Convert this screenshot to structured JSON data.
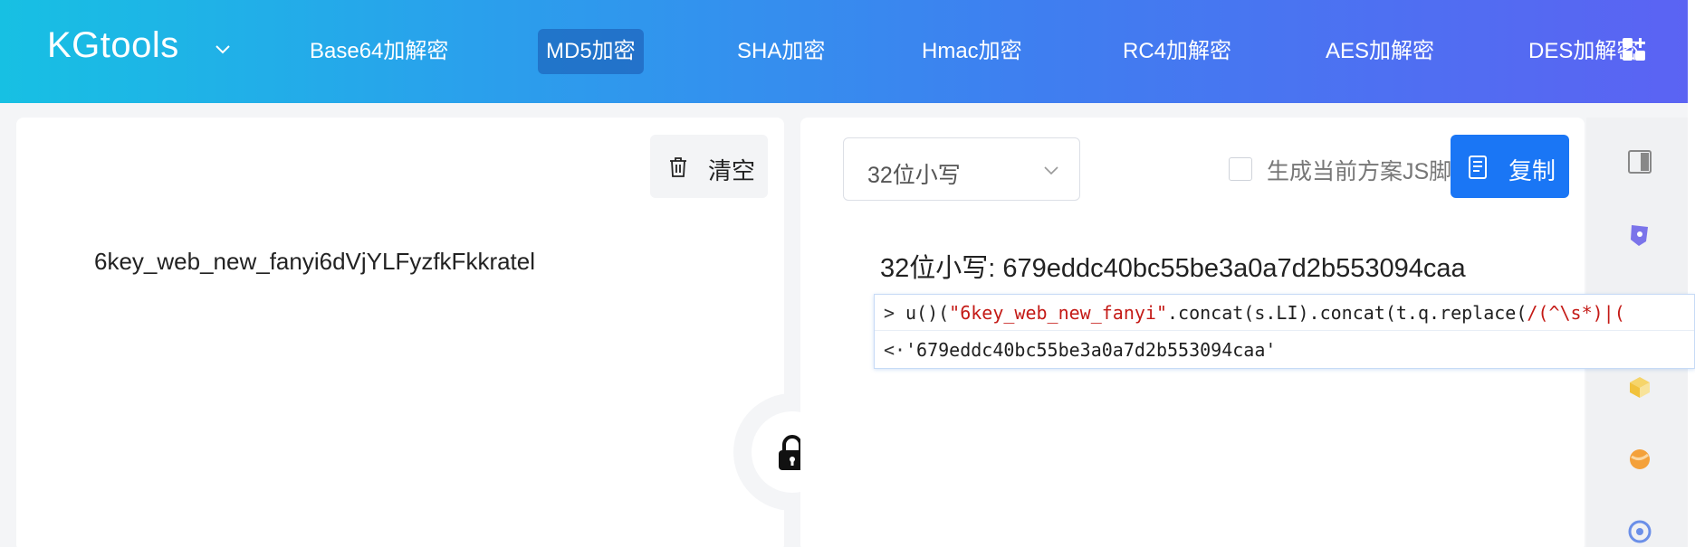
{
  "header": {
    "logo": "KGtools",
    "nav": [
      {
        "label": "Base64加解密",
        "active": false
      },
      {
        "label": "MD5加密",
        "active": true
      },
      {
        "label": "SHA加密",
        "active": false
      },
      {
        "label": "Hmac加密",
        "active": false
      },
      {
        "label": "RC4加解密",
        "active": false
      },
      {
        "label": "AES加解密",
        "active": false
      },
      {
        "label": "DES加解密",
        "active": false
      }
    ],
    "logo_menu_icon": "chevron-down-icon",
    "right_icon": "puzzle-add-icon"
  },
  "left_panel": {
    "clear_label": "清空",
    "clear_icon": "trash-icon",
    "input_value": "6key_web_new_fanyi6dVjYLFyzfkFkkratel",
    "lock_icon": "lock-icon"
  },
  "right_panel": {
    "mode_select": "32位小写",
    "checkbox_label": "生成当前方案JS脚本",
    "checkbox_checked": false,
    "copy_label": "复制",
    "copy_icon": "document-copy-icon",
    "result": "32位小写: 679eddc40bc55be3a0a7d2b553094caa"
  },
  "console": {
    "input_prompt": ">",
    "input_prefix": "u()(",
    "input_string": "\"6key_web_new_fanyi\"",
    "input_middle": ".concat(s.LI).concat(t.q.replace(",
    "input_regex": "/(^\\s*)|(",
    "output_prompt": "<·",
    "output_value": "'679eddc40bc55be3a0a7d2b553094caa'"
  },
  "sidebar_icons": [
    "panel-toggle-icon",
    "shield-icon",
    "cube-icon",
    "orange-ball-icon",
    "circle-logo-icon"
  ],
  "colors": {
    "header_gradient_start": "#17c0e3",
    "header_gradient_end": "#5b63f3",
    "primary_button": "#1a76f5",
    "console_string": "#c41a16"
  }
}
